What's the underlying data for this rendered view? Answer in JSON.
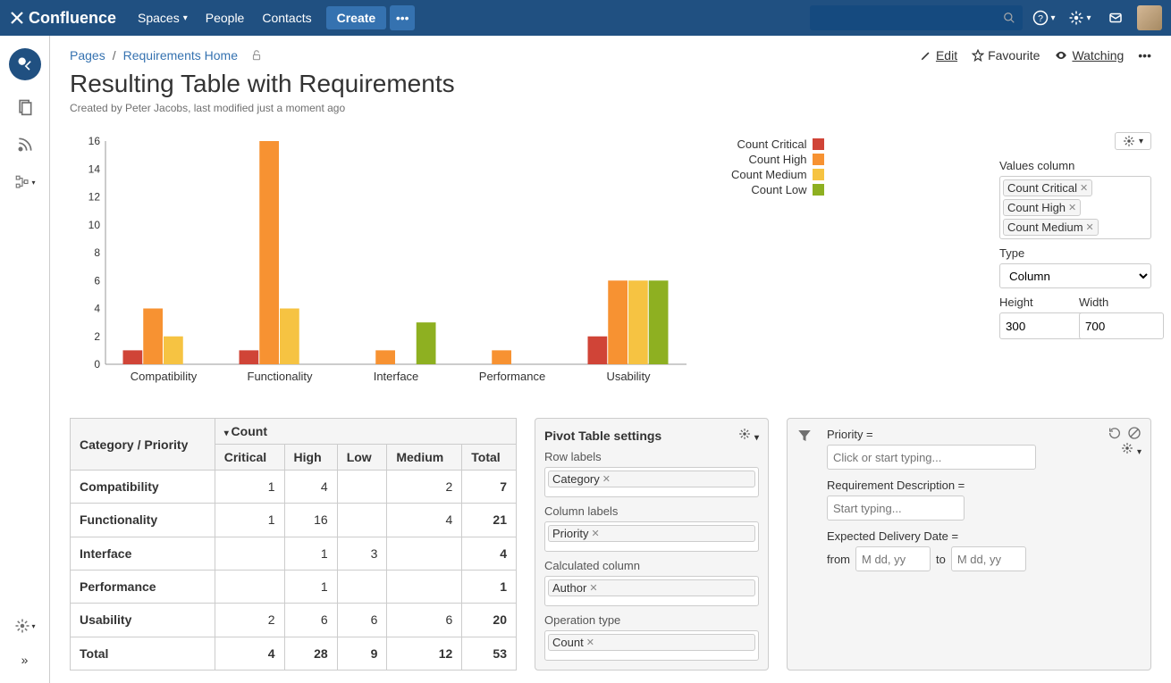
{
  "nav": {
    "app_name": "Confluence",
    "spaces": "Spaces",
    "people": "People",
    "contacts": "Contacts",
    "create": "Create"
  },
  "breadcrumb": {
    "pages": "Pages",
    "home": "Requirements Home"
  },
  "actions": {
    "edit": "Edit",
    "favourite": "Favourite",
    "watching": "Watching"
  },
  "page": {
    "title": "Resulting Table with Requirements",
    "meta": "Created by Peter Jacobs, last modified just a moment ago"
  },
  "chart_data": {
    "type": "bar",
    "categories": [
      "Compatibility",
      "Functionality",
      "Interface",
      "Performance",
      "Usability"
    ],
    "series": [
      {
        "name": "Count Critical",
        "color": "#d04437",
        "values": [
          1,
          1,
          0,
          0,
          2
        ]
      },
      {
        "name": "Count High",
        "color": "#f79232",
        "values": [
          4,
          16,
          1,
          1,
          6
        ]
      },
      {
        "name": "Count Medium",
        "color": "#f6c342",
        "values": [
          2,
          4,
          0,
          0,
          6
        ]
      },
      {
        "name": "Count Low",
        "color": "#8eb021",
        "values": [
          0,
          0,
          3,
          0,
          6
        ]
      }
    ],
    "ylim": [
      0,
      16
    ],
    "yticks": [
      0,
      2,
      4,
      6,
      8,
      10,
      12,
      14,
      16
    ]
  },
  "chart_opts": {
    "values_label": "Values column",
    "values_tags": [
      "Count Critical",
      "Count High",
      "Count Medium"
    ],
    "type_label": "Type",
    "type_value": "Column",
    "height_label": "Height",
    "height_value": "300",
    "width_label": "Width",
    "width_value": "700"
  },
  "table": {
    "corner_label": "Category / Priority",
    "count_label": "Count",
    "cols": [
      "Critical",
      "High",
      "Low",
      "Medium",
      "Total"
    ],
    "rows": [
      {
        "label": "Compatibility",
        "values": [
          "1",
          "4",
          "",
          "2",
          "7"
        ]
      },
      {
        "label": "Functionality",
        "values": [
          "1",
          "16",
          "",
          "4",
          "21"
        ]
      },
      {
        "label": "Interface",
        "values": [
          "",
          "1",
          "3",
          "",
          "4"
        ]
      },
      {
        "label": "Performance",
        "values": [
          "",
          "1",
          "",
          "",
          "1"
        ]
      },
      {
        "label": "Usability",
        "values": [
          "2",
          "6",
          "6",
          "6",
          "20"
        ]
      }
    ],
    "total_label": "Total",
    "totals": [
      "4",
      "28",
      "9",
      "12",
      "53"
    ]
  },
  "settings": {
    "header": "Pivot Table settings",
    "row_labels_lbl": "Row labels",
    "row_labels_tag": "Category",
    "col_labels_lbl": "Column labels",
    "col_labels_tag": "Priority",
    "calc_lbl": "Calculated column",
    "calc_tag": "Author",
    "op_lbl": "Operation type",
    "op_tag": "Count"
  },
  "filter": {
    "priority_lbl": "Priority =",
    "priority_ph": "Click or start typing...",
    "desc_lbl": "Requirement Description =",
    "desc_ph": "Start typing...",
    "date_lbl": "Expected Delivery Date =",
    "from_lbl": "from",
    "to_lbl": "to",
    "date_ph": "M dd, yy"
  }
}
